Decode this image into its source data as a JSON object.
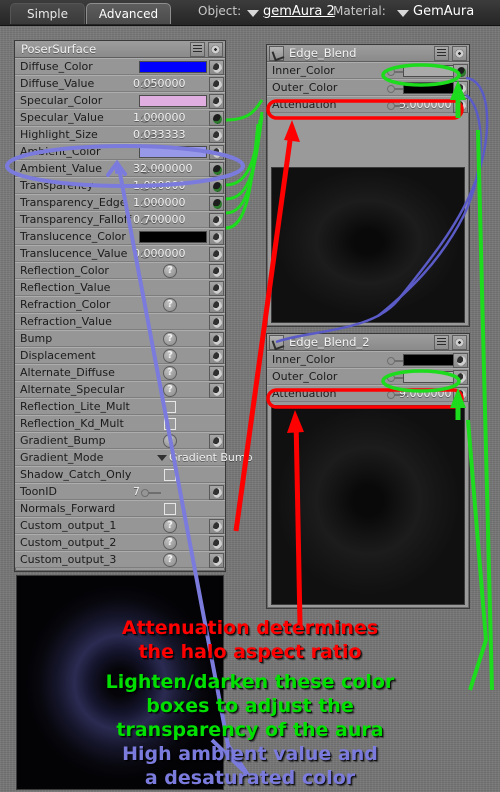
{
  "topbar": {
    "tabs": [
      {
        "label": "Simple",
        "active": false
      },
      {
        "label": "Advanced",
        "active": true
      }
    ],
    "object_label": "Object:",
    "object_value": "gemAura 2",
    "material_label": "Material:",
    "material_value": "GemAura"
  },
  "surface_panel": {
    "title": "PoserSurface",
    "header_buttons": [
      "list-icon",
      "eye-icon"
    ],
    "rows": [
      {
        "label": "Diffuse_Color",
        "type": "color",
        "value": "#0000ff",
        "key": true,
        "plug": "open"
      },
      {
        "label": "Diffuse_Value",
        "type": "number",
        "value": "0.050000",
        "key": true,
        "plug": "open"
      },
      {
        "label": "Specular_Color",
        "type": "color",
        "value": "#e0aee0",
        "key": true,
        "plug": "open"
      },
      {
        "label": "Specular_Value",
        "type": "number",
        "value": "1.000000",
        "key": true,
        "plug": "filled"
      },
      {
        "label": "Highlight_Size",
        "type": "number",
        "value": "0.033333",
        "key": true,
        "plug": "open"
      },
      {
        "label": "Ambient_Color",
        "type": "color",
        "value": "#9898e8",
        "key": true,
        "plug": "open"
      },
      {
        "label": "Ambient_Value",
        "type": "number",
        "value": "32.000000",
        "key": true,
        "plug": "filled"
      },
      {
        "label": "Transparency",
        "type": "number",
        "value": "1.000000",
        "key": true,
        "plug": "filled"
      },
      {
        "label": "Transparency_Edge",
        "type": "number",
        "value": "1.000000",
        "key": true,
        "plug": "filled"
      },
      {
        "label": "Transparency_Falloff",
        "type": "number",
        "value": "0.700000",
        "key": true,
        "plug": "open"
      },
      {
        "label": "Translucence_Color",
        "type": "color",
        "value": "#000000",
        "key": true,
        "plug": "open"
      },
      {
        "label": "Translucence_Value",
        "type": "number",
        "value": "0.000000",
        "key": true,
        "plug": "open"
      },
      {
        "label": "Reflection_Color",
        "type": "qmark",
        "value": "?",
        "key": false,
        "plug": "open"
      },
      {
        "label": "Reflection_Value",
        "type": "empty",
        "value": "",
        "key": false,
        "plug": "open"
      },
      {
        "label": "Refraction_Color",
        "type": "qmark",
        "value": "?",
        "key": false,
        "plug": "open"
      },
      {
        "label": "Refraction_Value",
        "type": "empty",
        "value": "",
        "key": false,
        "plug": "open"
      },
      {
        "label": "Bump",
        "type": "qmark",
        "value": "?",
        "key": false,
        "plug": "open"
      },
      {
        "label": "Displacement",
        "type": "qmark",
        "value": "?",
        "key": false,
        "plug": "open"
      },
      {
        "label": "Alternate_Diffuse",
        "type": "qmark",
        "value": "?",
        "key": false,
        "plug": "open"
      },
      {
        "label": "Alternate_Specular",
        "type": "qmark",
        "value": "?",
        "key": false,
        "plug": "open"
      },
      {
        "label": "Reflection_Lite_Mult",
        "type": "check",
        "value": "",
        "key": false,
        "plug": "none"
      },
      {
        "label": "Reflection_Kd_Mult",
        "type": "check",
        "value": "",
        "key": false,
        "plug": "none"
      },
      {
        "label": "Gradient_Bump",
        "type": "qmark",
        "value": "?",
        "key": false,
        "plug": "open"
      },
      {
        "label": "Gradient_Mode",
        "type": "dropdown",
        "value": "Gradient Bump",
        "key": false,
        "plug": "none"
      },
      {
        "label": "Shadow_Catch_Only",
        "type": "check",
        "value": "",
        "key": false,
        "plug": "none"
      },
      {
        "label": "ToonID",
        "type": "number",
        "value": "7",
        "key": true,
        "plug": "open"
      },
      {
        "label": "Normals_Forward",
        "type": "check",
        "value": "",
        "key": false,
        "plug": "none"
      },
      {
        "label": "Custom_output_1",
        "type": "qmark",
        "value": "?",
        "key": false,
        "plug": "open"
      },
      {
        "label": "Custom_output_2",
        "type": "qmark",
        "value": "?",
        "key": false,
        "plug": "open"
      },
      {
        "label": "Custom_output_3",
        "type": "qmark",
        "value": "?",
        "key": false,
        "plug": "open"
      }
    ]
  },
  "node_1": {
    "title": "Edge_Blend",
    "rows": [
      {
        "label": "Inner_Color",
        "type": "color",
        "value": "#aaaaaa",
        "key": true,
        "plug": "filled"
      },
      {
        "label": "Outer_Color",
        "type": "color",
        "value": "#000000",
        "key": true,
        "plug": "open"
      },
      {
        "label": "Attenuation",
        "type": "number",
        "value": "5.000000",
        "key": true,
        "plug": "open"
      }
    ]
  },
  "node_2": {
    "title": "Edge_Blend_2",
    "rows": [
      {
        "label": "Inner_Color",
        "type": "color",
        "value": "#000000",
        "key": true,
        "plug": "open"
      },
      {
        "label": "Outer_Color",
        "type": "color",
        "value": "#b4b4b4",
        "key": true,
        "plug": "open"
      },
      {
        "label": "Attenuation",
        "type": "number",
        "value": "9.000000",
        "key": true,
        "plug": "open"
      }
    ]
  },
  "annotations": {
    "red_line_1": "Attenuation determines",
    "red_line_2": "the halo aspect ratio",
    "green_line_1": "Lighten/darken these color",
    "green_line_2": "boxes to adjust the",
    "green_line_3": "transparency of the aura",
    "blue_line_1": "High ambient value and",
    "blue_line_2": "a desaturated color",
    "colors": {
      "red": "#ff0000",
      "green": "#00e000",
      "blue": "#7b7bdd"
    }
  }
}
